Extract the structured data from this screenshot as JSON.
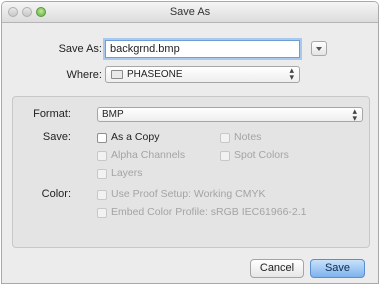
{
  "window": {
    "title": "Save As"
  },
  "top": {
    "save_as_label": "Save As:",
    "filename": "backgrnd.bmp",
    "where_label": "Where:",
    "where_value": "PHASEONE"
  },
  "options": {
    "format_label": "Format:",
    "format_value": "BMP",
    "save_label": "Save:",
    "color_label": "Color:",
    "checkboxes": {
      "as_a_copy": {
        "label": "As a Copy",
        "checked": false,
        "enabled": true
      },
      "notes": {
        "label": "Notes",
        "checked": false,
        "enabled": false
      },
      "alpha_channels": {
        "label": "Alpha Channels",
        "checked": false,
        "enabled": false
      },
      "spot_colors": {
        "label": "Spot Colors",
        "checked": false,
        "enabled": false
      },
      "layers": {
        "label": "Layers",
        "checked": false,
        "enabled": false
      },
      "use_proof_setup": {
        "label": "Use Proof Setup:  Working CMYK",
        "checked": false,
        "enabled": false
      },
      "embed_color_profile": {
        "label": "Embed Color Profile:  sRGB IEC61966-2.1",
        "checked": false,
        "enabled": false
      }
    }
  },
  "buttons": {
    "cancel": "Cancel",
    "save": "Save"
  },
  "icons": {
    "close": "close-icon",
    "minimize": "minimize-icon",
    "zoom": "zoom-icon",
    "folder": "folder-icon",
    "expand": "expand-icon"
  },
  "colors": {
    "accent": "#6e9ed6",
    "default_button": "#7db3ee"
  }
}
